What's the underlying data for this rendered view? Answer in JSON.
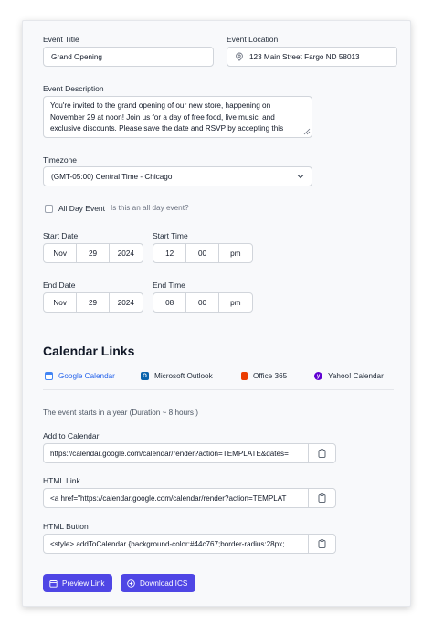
{
  "fields": {
    "title_label": "Event Title",
    "title_value": "Grand Opening",
    "location_label": "Event Location",
    "location_value": "123 Main Street Fargo ND 58013",
    "description_label": "Event Description",
    "description_value": "You're invited to the grand opening of our new store, happening on November 29 at noon! Join us for a day of free food, live music, and exclusive discounts. Please save the date and RSVP by accepting this calendar invite. We can't wait to celebrate with you!",
    "timezone_label": "Timezone",
    "timezone_value": "(GMT-05:00) Central Time - Chicago",
    "allday_label": "All Day Event",
    "allday_hint": "Is this an all day event?",
    "start_date_label": "Start Date",
    "start_date": {
      "month": "Nov",
      "day": "29",
      "year": "2024"
    },
    "start_time_label": "Start Time",
    "start_time": {
      "hour": "12",
      "minute": "00",
      "ampm": "pm"
    },
    "end_date_label": "End Date",
    "end_date": {
      "month": "Nov",
      "day": "29",
      "year": "2024"
    },
    "end_time_label": "End Time",
    "end_time": {
      "hour": "08",
      "minute": "00",
      "ampm": "pm"
    }
  },
  "links": {
    "heading": "Calendar Links",
    "tabs": [
      "Google Calendar",
      "Microsoft Outlook",
      "Office 365",
      "Yahoo! Calendar"
    ],
    "tab_icons": [
      "google-calendar-icon",
      "outlook-icon",
      "office365-icon",
      "yahoo-icon"
    ],
    "active_tab": "Google Calendar",
    "summary": "The event starts in a year (Duration ~ 8 hours )",
    "add_label": "Add to Calendar",
    "add_value": "https://calendar.google.com/calendar/render?action=TEMPLATE&dates=",
    "html_label": "HTML Link",
    "html_value": "<a href=\"https://calendar.google.com/calendar/render?action=TEMPLAT",
    "button_label": "HTML Button",
    "button_value": "<style>.addToCalendar {background-color:#44c767;border-radius:28px;",
    "preview_btn": "Preview Link",
    "download_btn": "Download ICS"
  },
  "colors": {
    "accent": "#4f46e5",
    "active_tab": "#2563eb"
  }
}
